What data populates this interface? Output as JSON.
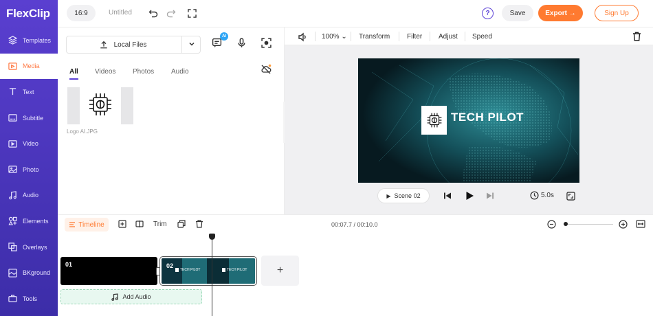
{
  "app": {
    "brand": "FlexClip"
  },
  "sidebar": {
    "items": [
      {
        "label": "Templates",
        "icon": "layers-icon"
      },
      {
        "label": "Media",
        "icon": "media-icon",
        "active": true
      },
      {
        "label": "Text",
        "icon": "text-icon"
      },
      {
        "label": "Subtitle",
        "icon": "subtitle-icon"
      },
      {
        "label": "Video",
        "icon": "video-icon"
      },
      {
        "label": "Photo",
        "icon": "photo-icon"
      },
      {
        "label": "Audio",
        "icon": "music-icon"
      },
      {
        "label": "Elements",
        "icon": "elements-icon"
      },
      {
        "label": "Overlays",
        "icon": "overlays-icon"
      },
      {
        "label": "BKground",
        "icon": "background-icon"
      },
      {
        "label": "Tools",
        "icon": "tools-icon"
      }
    ]
  },
  "topbar": {
    "ratio": "16:9",
    "title": "Untitled",
    "help": "?",
    "save": "Save",
    "export": "Export →",
    "signup": "Sign Up"
  },
  "media": {
    "local_files": "Local Files",
    "ai_badge": "AI",
    "tabs": [
      "All",
      "Videos",
      "Photos",
      "Audio"
    ],
    "active_tab": "All",
    "file_name": "Logo AI.JPG"
  },
  "preview": {
    "zoom": "100%",
    "tools": [
      "Transform",
      "Filter",
      "Adjust",
      "Speed"
    ],
    "video_text": "TECH PILOT",
    "scene": "Scene",
    "scene_number": "02",
    "duration": "5.0s"
  },
  "timeline": {
    "label": "Timeline",
    "trim": "Trim",
    "time": "00:07.7 / 00:10.0",
    "clips": [
      {
        "number": "01"
      },
      {
        "number": "02"
      }
    ],
    "add_clip": "+",
    "add_audio": "Add Audio",
    "thumb_text": "TECH PILOT"
  },
  "colors": {
    "accent": "#ff7a30",
    "brand_purple": "#5b41d6",
    "sidebar_top": "#5a3fd0",
    "sidebar_bottom": "#3c2da8"
  }
}
